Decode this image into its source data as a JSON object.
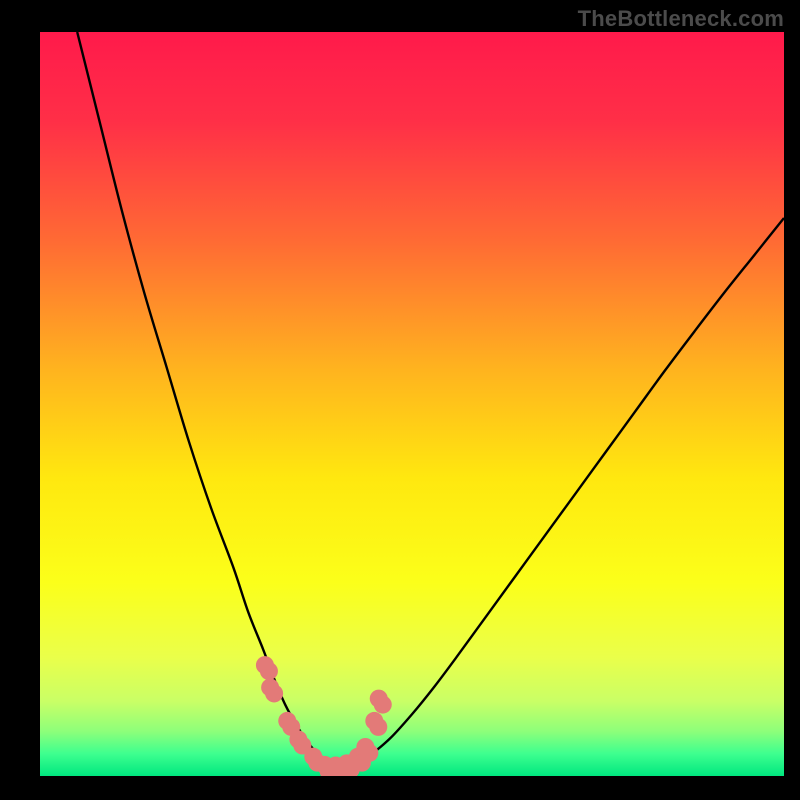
{
  "watermark": "TheBottleneck.com",
  "colors": {
    "frame": "#000000",
    "gradient_stops": [
      {
        "offset": 0.0,
        "color": "#ff1a4b"
      },
      {
        "offset": 0.12,
        "color": "#ff2f47"
      },
      {
        "offset": 0.28,
        "color": "#ff6a34"
      },
      {
        "offset": 0.45,
        "color": "#ffb21f"
      },
      {
        "offset": 0.6,
        "color": "#ffe80f"
      },
      {
        "offset": 0.74,
        "color": "#fbff1a"
      },
      {
        "offset": 0.84,
        "color": "#eaff4a"
      },
      {
        "offset": 0.9,
        "color": "#c9ff66"
      },
      {
        "offset": 0.94,
        "color": "#8dff7a"
      },
      {
        "offset": 0.97,
        "color": "#3eff8f"
      },
      {
        "offset": 1.0,
        "color": "#00e77f"
      }
    ],
    "curve": "#000000",
    "marker_fill": "#e37a78",
    "marker_stroke": "#c85a58"
  },
  "chart_data": {
    "type": "line",
    "title": "",
    "xlabel": "",
    "ylabel": "",
    "xlim": [
      0,
      100
    ],
    "ylim": [
      0,
      100
    ],
    "series": [
      {
        "name": "curve",
        "x": [
          5,
          8,
          11,
          14,
          17,
          20,
          23,
          26,
          28,
          30,
          31.5,
          33,
          34.5,
          36,
          38,
          40,
          42,
          44,
          47,
          50,
          53,
          56,
          60,
          64,
          68,
          72,
          76,
          80,
          84,
          88,
          92,
          96,
          100
        ],
        "y": [
          100,
          88,
          76,
          65,
          55,
          45,
          36,
          28,
          22,
          17,
          13,
          9.5,
          6.8,
          4.5,
          2.3,
          1.0,
          1.2,
          2.5,
          5.0,
          8.3,
          12.0,
          16.0,
          21.5,
          27.0,
          32.5,
          38.0,
          43.5,
          49.0,
          54.5,
          59.8,
          65.0,
          70.0,
          75.0
        ]
      }
    ],
    "markers": {
      "name": "highlight",
      "x": [
        30.5,
        31.2,
        33.5,
        35.0,
        37.0,
        38.5,
        40.0,
        41.5,
        43.0,
        44.0,
        45.2,
        45.8
      ],
      "y": [
        14.5,
        11.5,
        7.0,
        4.5,
        2.2,
        1.1,
        1.0,
        1.3,
        2.2,
        3.5,
        7.0,
        10.0
      ]
    }
  }
}
